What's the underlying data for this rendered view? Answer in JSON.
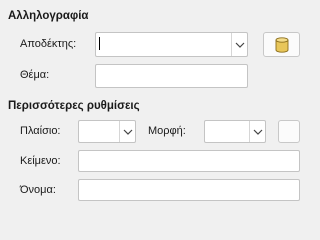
{
  "correspondence": {
    "title": "Αλληλογραφία",
    "recipient_label": "Αποδέκτης:",
    "recipient_value": "",
    "subject_label": "Θέμα:",
    "subject_value": ""
  },
  "more_settings": {
    "title": "Περισσότερες ρυθμίσεις",
    "frame_label": "Πλαίσιο:",
    "frame_value": "",
    "format_label": "Μορφή:",
    "format_value": "",
    "text_label": "Κείμενο:",
    "text_value": "",
    "name_label": "Όνομα:",
    "name_value": ""
  },
  "icons": {
    "address_book": "database-icon",
    "dropdown": "chevron-down-icon"
  },
  "colors": {
    "background": "#f0f0f0",
    "field_border": "#c4c4c4",
    "database_icon": "#e8c65a"
  }
}
